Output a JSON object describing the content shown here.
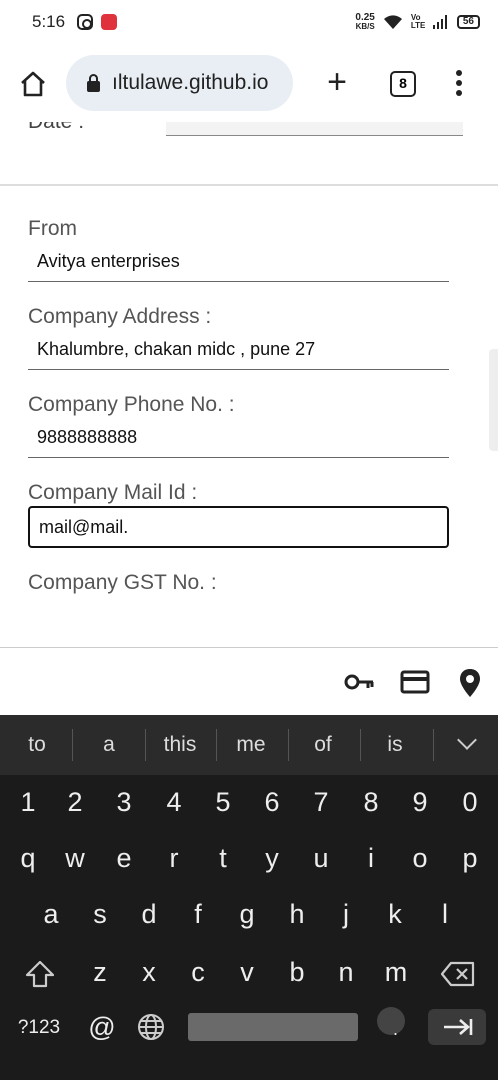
{
  "status_bar": {
    "time": "5:16",
    "net_speed_value": "0.25",
    "net_speed_unit": "KB/S",
    "network": "Vo LTE",
    "battery": "56"
  },
  "browser": {
    "url": "ıltulawe.github.io",
    "tab_count": "8"
  },
  "form": {
    "date_label": "Date :",
    "fields": [
      {
        "label": "From",
        "value": "Avitya enterprises"
      },
      {
        "label": "Company Address :",
        "value": "Khalumbre, chakan midc , pune 27"
      },
      {
        "label": "Company Phone No. :",
        "value": "9888888888"
      },
      {
        "label": "Company Mail Id :",
        "value": "mail@mail."
      },
      {
        "label": "Company GST No. :",
        "value": ""
      }
    ]
  },
  "keyboard": {
    "suggestions": [
      "to",
      "a",
      "this",
      "me",
      "of",
      "is"
    ],
    "number_row": [
      "1",
      "2",
      "3",
      "4",
      "5",
      "6",
      "7",
      "8",
      "9",
      "0"
    ],
    "row1": [
      "q",
      "w",
      "e",
      "r",
      "t",
      "y",
      "u",
      "i",
      "o",
      "p"
    ],
    "row2": [
      "a",
      "s",
      "d",
      "f",
      "g",
      "h",
      "j",
      "k",
      "l"
    ],
    "row3": [
      "z",
      "x",
      "c",
      "v",
      "b",
      "n",
      "m"
    ],
    "symbols_key": "?123",
    "at_key": "@",
    "period_key": "."
  }
}
